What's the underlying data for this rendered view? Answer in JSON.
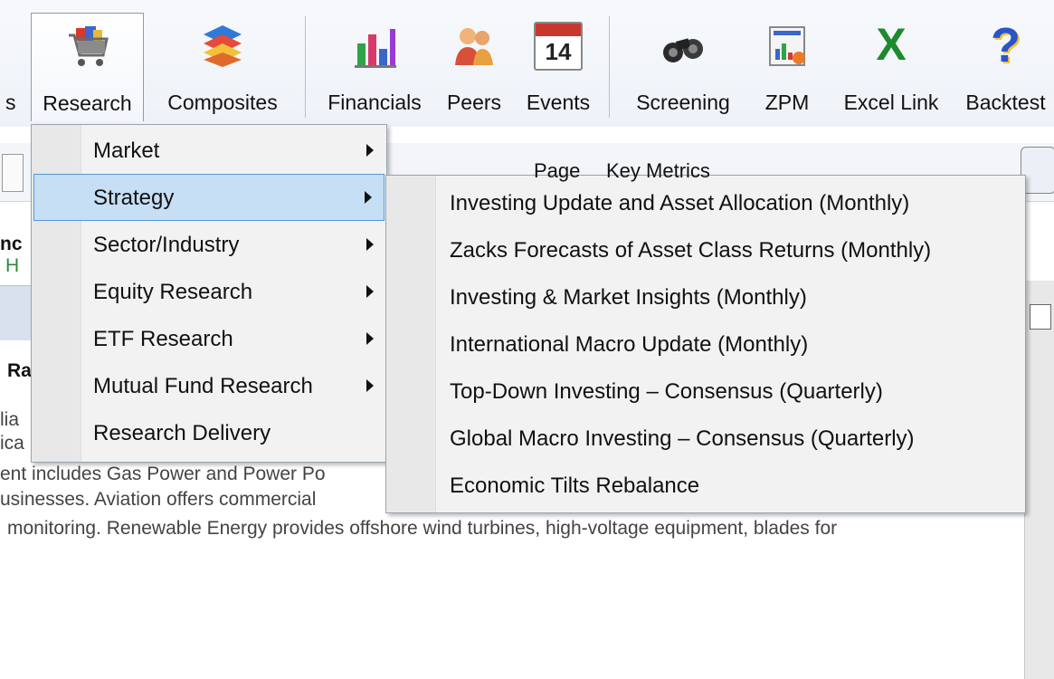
{
  "ribbon": {
    "items": [
      {
        "label": "s",
        "icon": "partial-icon"
      },
      {
        "label": "Research",
        "icon": "shopping-cart-icon"
      },
      {
        "label": "Composites",
        "icon": "stacked-layers-icon"
      },
      {
        "label": "Financials",
        "icon": "bar-chart-icon"
      },
      {
        "label": "Peers",
        "icon": "people-icon"
      },
      {
        "label": "Events",
        "icon": "calendar-icon",
        "calendar_day": "14"
      },
      {
        "label": "Screening",
        "icon": "binoculars-icon"
      },
      {
        "label": "ZPM",
        "icon": "portfolio-chart-icon"
      },
      {
        "label": "Excel Link",
        "icon": "excel-icon",
        "excel_letter": "X"
      },
      {
        "label": "Backtest",
        "icon": "question-icon",
        "question_mark": "?"
      }
    ]
  },
  "background": {
    "fragments": [
      "nc",
      "H",
      "Ra",
      "lia",
      "ica",
      "Page",
      "Key Metrics"
    ],
    "description_lines": [
      "ent includes Gas Power and Power Po",
      "usinesses. Aviation offers commercial",
      "monitoring. Renewable Energy provides offshore wind turbines, high-voltage equipment, blades for"
    ]
  },
  "research_menu": {
    "items": [
      {
        "label": "Market",
        "has_submenu": true
      },
      {
        "label": "Strategy",
        "has_submenu": true,
        "selected": true
      },
      {
        "label": "Sector/Industry",
        "has_submenu": true
      },
      {
        "label": "Equity Research",
        "has_submenu": true
      },
      {
        "label": "ETF Research",
        "has_submenu": true
      },
      {
        "label": "Mutual Fund Research",
        "has_submenu": true
      },
      {
        "label": "Research Delivery",
        "has_submenu": false
      }
    ]
  },
  "strategy_submenu": {
    "items": [
      "Investing Update and Asset Allocation (Monthly)",
      "Zacks Forecasts of Asset Class Returns (Monthly)",
      "Investing & Market Insights (Monthly)",
      "International Macro Update (Monthly)",
      "Top-Down Investing – Consensus (Quarterly)",
      "Global Macro Investing – Consensus (Quarterly)",
      "Economic Tilts Rebalance"
    ]
  },
  "colors": {
    "selection": "#c6dff5",
    "selection_border": "#5a97d4",
    "menu_bg": "#f2f2f2",
    "excel_green": "#1e8a2e",
    "question_blue": "#2a55c8"
  }
}
